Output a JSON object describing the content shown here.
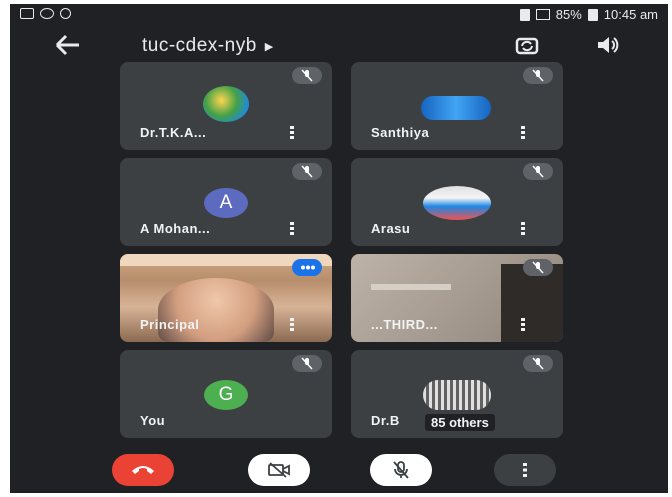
{
  "status_bar": {
    "battery": "85%",
    "time": "10:45 am"
  },
  "meeting": {
    "code": "tuc-cdex-nyb"
  },
  "participants": [
    {
      "name": "Dr.T.K.A...",
      "avatar": "image"
    },
    {
      "name": "Santhiya",
      "avatar": "image"
    },
    {
      "name": "A Mohan...",
      "avatar": "letter",
      "initial": "A",
      "color": "#5c6bc0"
    },
    {
      "name": "Arasu",
      "avatar": "image"
    },
    {
      "name": "Principal",
      "avatar": "video",
      "speaking": true
    },
    {
      "name": "...THIRD...",
      "avatar": "video"
    },
    {
      "name": "You",
      "avatar": "letter",
      "initial": "G",
      "color": "#4caf50"
    },
    {
      "name": "Dr.B",
      "avatar": "image",
      "overflow_label": "85 others"
    }
  ],
  "controls": {
    "end_call_color": "#ea4335",
    "icons": [
      "end-call-icon",
      "camera-off-icon",
      "mic-off-icon",
      "more-vert-icon"
    ]
  },
  "colors": {
    "background": "#202124",
    "tile": "#3c4043",
    "accent": "#1a73e8"
  }
}
